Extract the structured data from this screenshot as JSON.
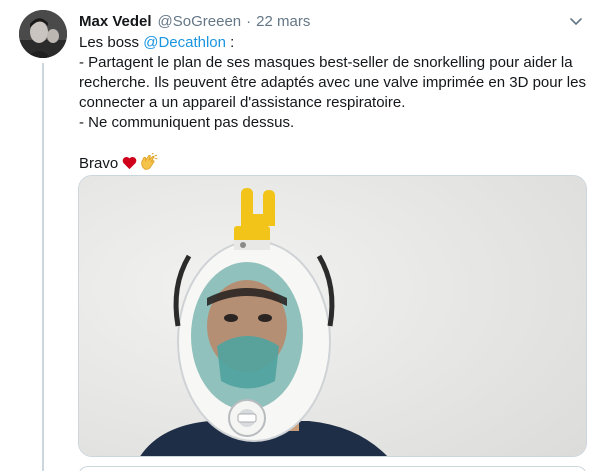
{
  "tweet": {
    "author_name": "Max Vedel",
    "handle": "@SoGreeen",
    "separator": "·",
    "date": "22 mars",
    "line1_prefix": "Les boss ",
    "mention": "@Decathlon",
    "line1_suffix": " :",
    "line2": "- Partagent le plan de ses masques best-seller de snorkelling pour aider la recherche. Ils peuvent être adaptés avec une valve imprimée en 3D pour les connecter a un appareil d'assistance respiratoire.",
    "line3": "- Ne communiquent pas dessus.",
    "closing": "Bravo"
  },
  "icons": [
    "avatar",
    "chevron-down-icon",
    "red-heart-icon",
    "clapping-hands-icon"
  ],
  "colors": {
    "link": "#1b95e0",
    "secondary_text": "#657786",
    "border": "#ccd6dd",
    "heart": "#d0021b",
    "clap": "#f5c24a"
  }
}
